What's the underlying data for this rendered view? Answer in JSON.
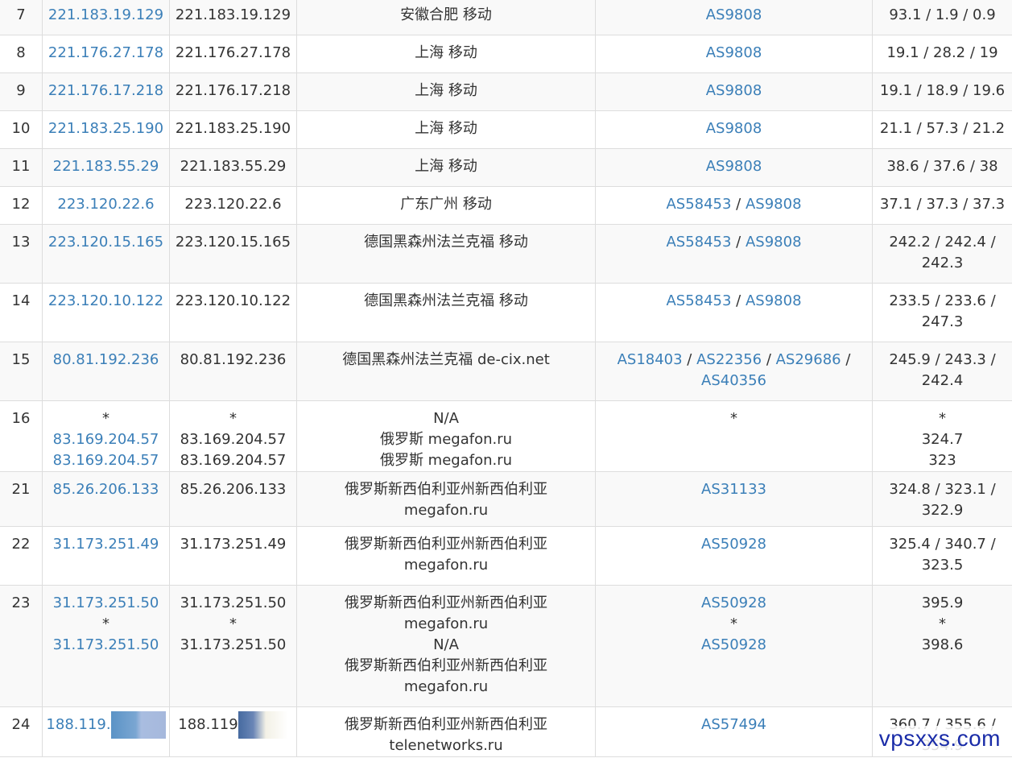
{
  "rows": [
    {
      "hop": "7",
      "ip_link": [
        "221.183.19.129"
      ],
      "ip": [
        "221.183.19.129"
      ],
      "loc": [
        "安徽合肥 移动"
      ],
      "asn": [
        [
          "AS9808"
        ]
      ],
      "rtt": [
        "93.1 / 1.9 / 0.9"
      ]
    },
    {
      "hop": "8",
      "ip_link": [
        "221.176.27.178"
      ],
      "ip": [
        "221.176.27.178"
      ],
      "loc": [
        "上海 移动"
      ],
      "asn": [
        [
          "AS9808"
        ]
      ],
      "rtt": [
        "19.1 / 28.2 / 19"
      ]
    },
    {
      "hop": "9",
      "ip_link": [
        "221.176.17.218"
      ],
      "ip": [
        "221.176.17.218"
      ],
      "loc": [
        "上海 移动"
      ],
      "asn": [
        [
          "AS9808"
        ]
      ],
      "rtt": [
        "19.1 / 18.9 / 19.6"
      ]
    },
    {
      "hop": "10",
      "ip_link": [
        "221.183.25.190"
      ],
      "ip": [
        "221.183.25.190"
      ],
      "loc": [
        "上海 移动"
      ],
      "asn": [
        [
          "AS9808"
        ]
      ],
      "rtt": [
        "21.1 / 57.3 / 21.2"
      ]
    },
    {
      "hop": "11",
      "ip_link": [
        "221.183.55.29"
      ],
      "ip": [
        "221.183.55.29"
      ],
      "loc": [
        "上海 移动"
      ],
      "asn": [
        [
          "AS9808"
        ]
      ],
      "rtt": [
        "38.6 / 37.6 / 38"
      ]
    },
    {
      "hop": "12",
      "ip_link": [
        "223.120.22.6"
      ],
      "ip": [
        "223.120.22.6"
      ],
      "loc": [
        "广东广州 移动"
      ],
      "asn": [
        [
          "AS58453",
          "AS9808"
        ]
      ],
      "rtt": [
        "37.1 / 37.3 / 37.3"
      ]
    },
    {
      "hop": "13",
      "ip_link": [
        "223.120.15.165"
      ],
      "ip": [
        "223.120.15.165"
      ],
      "loc": [
        "德国黑森州法兰克福 移动"
      ],
      "asn": [
        [
          "AS58453",
          "AS9808"
        ]
      ],
      "rtt": [
        "242.2 / 242.4 /",
        "242.3"
      ]
    },
    {
      "hop": "14",
      "ip_link": [
        "223.120.10.122"
      ],
      "ip": [
        "223.120.10.122"
      ],
      "loc": [
        "德国黑森州法兰克福 移动"
      ],
      "asn": [
        [
          "AS58453",
          "AS9808"
        ]
      ],
      "rtt": [
        "233.5 / 233.6 /",
        "247.3"
      ]
    },
    {
      "hop": "15",
      "ip_link": [
        "80.81.192.236"
      ],
      "ip": [
        "80.81.192.236"
      ],
      "loc": [
        "德国黑森州法兰克福 de-cix.net"
      ],
      "asn": [
        [
          "AS18403",
          "AS22356",
          "AS29686"
        ],
        [
          "AS40356"
        ]
      ],
      "asn_trailing_sep": true,
      "rtt": [
        "245.9 / 243.3 /",
        "242.4"
      ]
    },
    {
      "hop": "16",
      "ip_link": [
        "*",
        "83.169.204.57",
        "83.169.204.57"
      ],
      "ip": [
        "*",
        "83.169.204.57",
        "83.169.204.57"
      ],
      "loc": [
        "N/A",
        "俄罗斯 megafon.ru",
        "俄罗斯 megafon.ru"
      ],
      "asn_plain": [
        "*"
      ],
      "rtt": [
        "*",
        "324.7",
        "323"
      ]
    },
    {
      "hop": "21",
      "ip_link": [
        "85.26.206.133"
      ],
      "ip": [
        "85.26.206.133"
      ],
      "loc": [
        "俄罗斯新西伯利亚州新西伯利亚",
        "megafon.ru"
      ],
      "asn": [
        [
          "AS31133"
        ]
      ],
      "rtt": [
        "324.8 / 323.1 /",
        "322.9"
      ]
    },
    {
      "hop": "22",
      "ip_link": [
        "31.173.251.49"
      ],
      "ip": [
        "31.173.251.49"
      ],
      "loc": [
        "俄罗斯新西伯利亚州新西伯利亚",
        "megafon.ru"
      ],
      "asn": [
        [
          "AS50928"
        ]
      ],
      "rtt": [
        "325.4 / 340.7 /",
        "323.5"
      ]
    },
    {
      "hop": "23",
      "ip_link": [
        "31.173.251.50",
        "*",
        "31.173.251.50"
      ],
      "ip": [
        "31.173.251.50",
        "*",
        "31.173.251.50"
      ],
      "loc": [
        "俄罗斯新西伯利亚州新西伯利亚",
        "megafon.ru",
        "N/A",
        "俄罗斯新西伯利亚州新西伯利亚",
        "megafon.ru"
      ],
      "asn_mixed": [
        "AS50928",
        "*",
        "AS50928"
      ],
      "rtt": [
        "395.9",
        "*",
        "398.6"
      ]
    },
    {
      "hop": "24",
      "ip_link": [
        "188.119."
      ],
      "ip": [
        "188.119"
      ],
      "redacted": true,
      "loc": [
        "俄罗斯新西伯利亚州新西伯利亚",
        "telenetworks.ru"
      ],
      "asn": [
        [
          "AS57494"
        ]
      ],
      "rtt": [
        "360.7 / 355.6 /",
        "354.9"
      ]
    }
  ],
  "watermark": "vpsxxs.com",
  "colors": {
    "link": "#3b7fb8",
    "text": "#333333",
    "border": "#dddddd",
    "stripe": "#f9f9f9",
    "watermark": "#1a2ca8"
  }
}
